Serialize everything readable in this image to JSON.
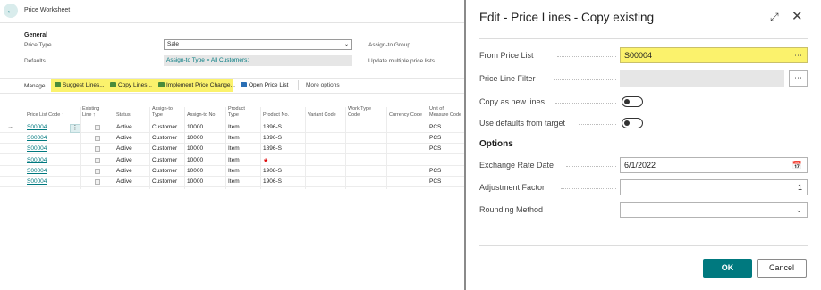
{
  "worksheet": {
    "title": "Price Worksheet",
    "general": {
      "section": "General",
      "price_type_label": "Price Type",
      "price_type_value": "Sale",
      "defaults_label": "Defaults",
      "defaults_value": "Assign-to Type = All Customers:",
      "assign_to_group_label": "Assign-to Group",
      "update_multiple_label": "Update multiple price lists"
    },
    "actions": {
      "manage": "Manage",
      "suggest_lines": "Suggest Lines...",
      "copy_lines": "Copy Lines...",
      "implement_price_change": "Implement Price Change...",
      "open_price_list": "Open Price List",
      "more_options": "More options"
    },
    "columns": {
      "price_list_code": "Price List Code ↑",
      "existing_line_1": "Existing",
      "existing_line_2": "Line ↑",
      "status": "Status",
      "assign_to_type_1": "Assign-to",
      "assign_to_type_2": "Type",
      "assign_to_no": "Assign-to No.",
      "product_type_1": "Product",
      "product_type_2": "Type",
      "product_no": "Product No.",
      "variant_code": "Variant Code",
      "work_type_code_1": "Work Type",
      "work_type_code_2": "Code",
      "currency_code": "Currency Code",
      "unit_of_measure_1": "Unit of",
      "unit_of_measure_2": "Measure Code"
    },
    "rows": [
      {
        "code": "S00004",
        "status": "Active",
        "assign_type": "Customer",
        "assign_no": "10000",
        "product_type": "Item",
        "product_no": "1896-S",
        "uom": "PCS"
      },
      {
        "code": "S00004",
        "status": "Active",
        "assign_type": "Customer",
        "assign_no": "10000",
        "product_type": "Item",
        "product_no": "1896-S",
        "uom": "PCS"
      },
      {
        "code": "S00004",
        "status": "Active",
        "assign_type": "Customer",
        "assign_no": "10000",
        "product_type": "Item",
        "product_no": "1896-S",
        "uom": "PCS"
      },
      {
        "code": "S00004",
        "status": "Active",
        "assign_type": "Customer",
        "assign_no": "10000",
        "product_type": "Item",
        "product_no": "",
        "uom": ""
      },
      {
        "code": "S00004",
        "status": "Active",
        "assign_type": "Customer",
        "assign_no": "10000",
        "product_type": "Item",
        "product_no": "1908-S",
        "uom": "PCS"
      },
      {
        "code": "S00004",
        "status": "Active",
        "assign_type": "Customer",
        "assign_no": "10000",
        "product_type": "Item",
        "product_no": "1906-S",
        "uom": "PCS"
      }
    ],
    "required_marker": "*"
  },
  "dialog": {
    "title": "Edit - Price Lines - Copy existing",
    "from_price_list_label": "From Price List",
    "from_price_list_value": "S00004",
    "price_line_filter_label": "Price Line Filter",
    "price_line_filter_value": "",
    "copy_as_new_lines_label": "Copy as new lines",
    "use_defaults_label": "Use defaults from target",
    "options_section": "Options",
    "exchange_rate_date_label": "Exchange Rate Date",
    "exchange_rate_date_value": "6/1/2022",
    "adjustment_factor_label": "Adjustment Factor",
    "adjustment_factor_value": "1",
    "rounding_method_label": "Rounding Method",
    "rounding_method_value": "",
    "ok_label": "OK",
    "cancel_label": "Cancel",
    "ellipsis": "⋯"
  },
  "colors": {
    "accent": "#00797f",
    "highlight": "#fbf26c"
  }
}
